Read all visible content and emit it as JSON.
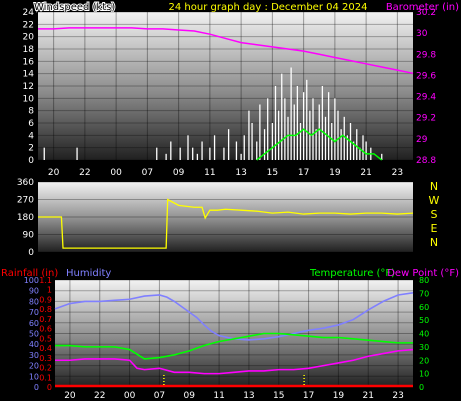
{
  "header": {
    "left_label": "Windspeed (kts)",
    "center_label": "24 hour graph day : December 04 2024",
    "right_label": "Barometer (in)"
  },
  "colors": {
    "background": "#000000",
    "windspeed": "#ffffff",
    "wind_avg": "#00ff00",
    "barometer": "#ff00ff",
    "direction": "#ffff00",
    "humidity": "#8080ff",
    "temperature": "#00ff00",
    "dewpoint": "#ff00ff",
    "rainfall": "#ff0000",
    "header_text": "#ffff00"
  },
  "time_ticks": [
    "20",
    "22",
    "00",
    "07",
    "09",
    "11",
    "13",
    "15",
    "17",
    "19",
    "21",
    "23"
  ],
  "chart_data": [
    {
      "type": "line",
      "name": "wind-barometer",
      "ylabel": "Windspeed (kts)",
      "ylim": [
        0,
        24
      ],
      "yticks": [
        0,
        2,
        4,
        6,
        8,
        10,
        12,
        14,
        16,
        18,
        20,
        22,
        24
      ],
      "ylabel2": "Barometer (in)",
      "ylim2": [
        28.8,
        30.2
      ],
      "yticks2": [
        "28.8",
        "29",
        "29.2",
        "29.4",
        "29.6",
        "29.8",
        "30",
        "30.2"
      ],
      "grid": true,
      "series": [
        {
          "name": "Barometer (in)",
          "axis": "right",
          "x": [
            0,
            1,
            2,
            3,
            4,
            5,
            6,
            7,
            8,
            9,
            10,
            11,
            12,
            13,
            14,
            15,
            16,
            17,
            18,
            19,
            20,
            21,
            22,
            23,
            24
          ],
          "values": [
            30.04,
            30.04,
            30.05,
            30.05,
            30.05,
            30.05,
            30.05,
            30.04,
            30.04,
            30.03,
            30.02,
            29.99,
            29.95,
            29.91,
            29.89,
            29.87,
            29.85,
            29.83,
            29.8,
            29.77,
            29.74,
            29.71,
            29.68,
            29.65,
            29.62
          ]
        },
        {
          "name": "Windspeed",
          "style": "gusts",
          "x": [
            0.4,
            2.5,
            7.3,
            7.6,
            7.9,
            8.2,
            8.5,
            8.8,
            9.1,
            9.3,
            9.6,
            9.9,
            10.2,
            10.5,
            10.8,
            11.0,
            11.3,
            11.6,
            11.9,
            12.2,
            12.4,
            12.7,
            13.0,
            13.2,
            13.5,
            13.7,
            14.0,
            14.2,
            14.5,
            14.7,
            15.0,
            15.2,
            15.4,
            15.6,
            15.8,
            16.0,
            16.2,
            16.4,
            16.6,
            16.8,
            17.0,
            17.2,
            17.4,
            17.6,
            17.8,
            18.0,
            18.2,
            18.4,
            18.6,
            18.8,
            19.0,
            19.2,
            19.4,
            19.6,
            19.8,
            20.0,
            20.2,
            20.4,
            20.6,
            20.8,
            21.0,
            21.3,
            21.6,
            22.0
          ],
          "values": [
            2,
            2,
            0,
            2,
            0,
            1,
            3,
            0,
            2,
            0,
            4,
            2,
            1,
            3,
            0,
            2,
            4,
            0,
            2,
            5,
            0,
            3,
            1,
            4,
            8,
            6,
            3,
            9,
            5,
            10,
            6,
            12,
            8,
            14,
            10,
            7,
            15,
            9,
            12,
            6,
            11,
            13,
            8,
            10,
            5,
            9,
            12,
            7,
            11,
            6,
            10,
            8,
            5,
            7,
            4,
            6,
            3,
            5,
            2,
            4,
            3,
            2,
            0,
            1
          ]
        },
        {
          "name": "Wind average",
          "style": "line",
          "x": [
            14.0,
            14.5,
            15.0,
            15.5,
            16.0,
            16.5,
            17.0,
            17.5,
            18.0,
            18.5,
            19.0,
            19.5,
            20.0,
            20.5,
            21.0,
            21.5,
            22.0
          ],
          "values": [
            0,
            1,
            2,
            3,
            4,
            4,
            5,
            4,
            5,
            4,
            3,
            4,
            3,
            2,
            1,
            1,
            0
          ]
        }
      ]
    },
    {
      "type": "line",
      "name": "wind-direction",
      "ylim": [
        0,
        360
      ],
      "yticks": [
        0,
        90,
        180,
        270,
        360
      ],
      "side_labels": [
        "N",
        "W",
        "S",
        "E",
        "N"
      ],
      "grid": true,
      "series": [
        {
          "name": "Wind direction",
          "x": [
            0,
            1.5,
            1.6,
            5,
            7,
            8,
            8.2,
            8.3,
            9,
            10,
            10.5,
            10.7,
            11,
            11.5,
            12,
            13,
            14,
            15,
            16,
            17,
            18,
            19,
            20,
            21,
            22,
            23,
            24
          ],
          "values": [
            180,
            180,
            20,
            20,
            20,
            20,
            20,
            270,
            240,
            230,
            230,
            175,
            215,
            215,
            220,
            215,
            210,
            200,
            205,
            195,
            200,
            200,
            195,
            200,
            200,
            195,
            200
          ]
        }
      ]
    },
    {
      "type": "line",
      "name": "humidity-temperature",
      "ylabel": "Humidity",
      "ylim": [
        0,
        100
      ],
      "yticks": [
        0,
        10,
        20,
        30,
        40,
        50,
        60,
        70,
        80,
        90,
        100
      ],
      "ylabel2": "Temperature (°F)",
      "ylim2": [
        0,
        80
      ],
      "yticks2": [
        0,
        10,
        20,
        30,
        40,
        50,
        60,
        70,
        80
      ],
      "rain_label": "Rainfall (in)",
      "rain_ylim": [
        0,
        1.1
      ],
      "rain_yticks": [
        "0",
        "0.1",
        "0.2",
        "0.3",
        "0.4",
        "0.5",
        "0.6",
        "0.7",
        "0.8",
        "0.9",
        "1",
        "1.1"
      ],
      "dew_label": "Dew Point (°F)",
      "grid": true,
      "series": [
        {
          "name": "Humidity",
          "axis": "left",
          "x": [
            0,
            1,
            2,
            3,
            4,
            5,
            6,
            7,
            7.5,
            8,
            8.5,
            9,
            9.5,
            10,
            10.5,
            11,
            12,
            13,
            14,
            15,
            16,
            17,
            18,
            19,
            20,
            21,
            22,
            23,
            24
          ],
          "values": [
            73,
            78,
            80,
            80,
            81,
            82,
            85,
            86,
            84,
            80,
            75,
            70,
            65,
            58,
            52,
            48,
            45,
            44,
            45,
            47,
            50,
            53,
            55,
            58,
            63,
            72,
            80,
            86,
            88
          ]
        },
        {
          "name": "Temperature (°F)",
          "axis": "right",
          "x": [
            0,
            1,
            2,
            3,
            4,
            5,
            6,
            7,
            8,
            9,
            10,
            11,
            12,
            13,
            14,
            15,
            16,
            17,
            18,
            19,
            20,
            21,
            22,
            23,
            24
          ],
          "values": [
            31,
            31,
            30,
            30,
            30,
            28,
            21,
            22,
            24,
            27,
            31,
            34,
            36,
            38,
            40,
            40,
            39,
            38,
            37,
            37,
            36,
            35,
            34,
            33,
            33
          ]
        },
        {
          "name": "Dew Point (°F)",
          "axis": "right",
          "x": [
            0,
            1,
            2,
            3,
            4,
            5,
            5.5,
            6,
            7,
            8,
            9,
            10,
            11,
            12,
            13,
            14,
            15,
            16,
            17,
            18,
            19,
            20,
            21,
            22,
            23,
            24
          ],
          "values": [
            20,
            20,
            21,
            21,
            21,
            20,
            14,
            13,
            14,
            11,
            11,
            10,
            10,
            11,
            12,
            12,
            13,
            13,
            14,
            16,
            18,
            20,
            23,
            25,
            27,
            28
          ]
        },
        {
          "name": "Rainfall (in)",
          "axis": "rain",
          "x": [
            0,
            24
          ],
          "values": [
            0,
            0
          ]
        }
      ]
    }
  ]
}
